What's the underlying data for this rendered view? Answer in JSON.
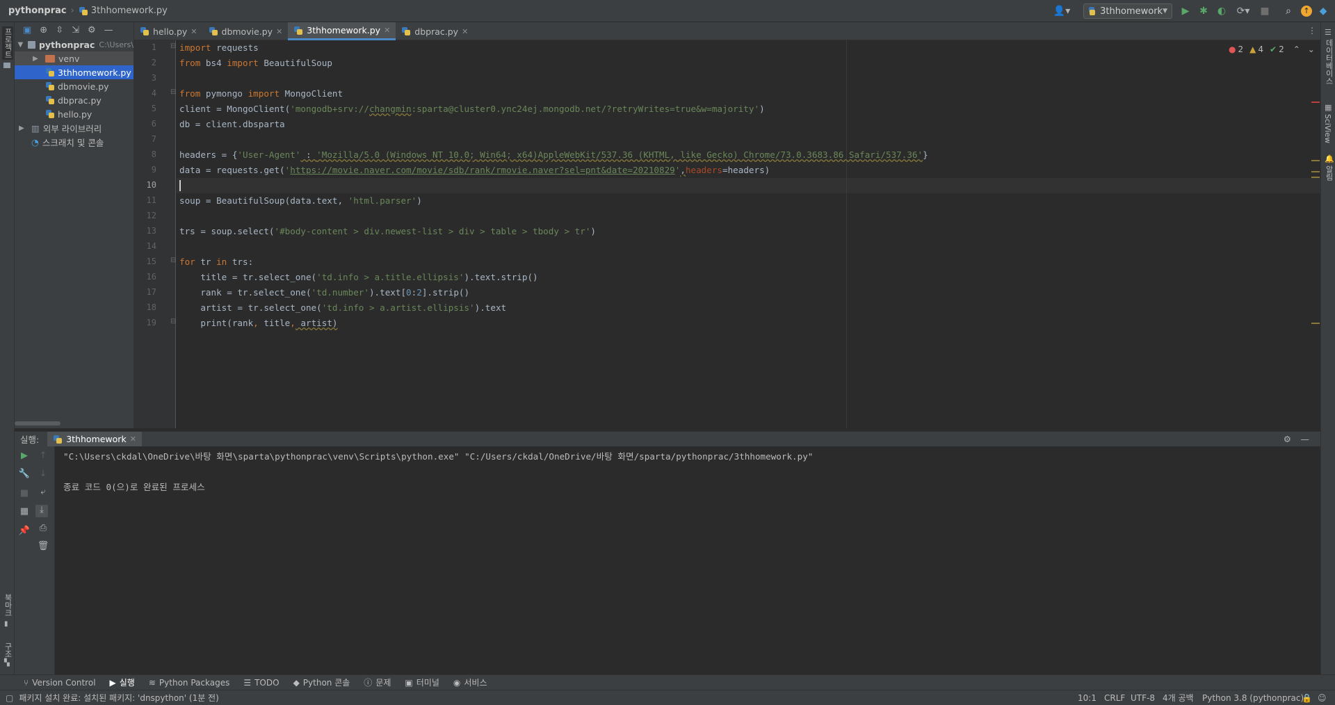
{
  "breadcrumb": {
    "project": "pythonprac",
    "file": "3thhomework.py"
  },
  "toolbar": {
    "run_config": "3thhomework"
  },
  "left_strip": {
    "project_label": "프로젝트",
    "bookmarks_label": "북마크",
    "structure_label": "구조"
  },
  "right_strip": {
    "database_label": "데이터베이스",
    "sciview_label": "SciView",
    "notifications_label": "알림"
  },
  "project_tree": {
    "root_name": "pythonprac",
    "root_path": "C:\\Users\\",
    "items": [
      {
        "label": "venv"
      },
      {
        "label": "3thhomework.py"
      },
      {
        "label": "dbmovie.py"
      },
      {
        "label": "dbprac.py"
      },
      {
        "label": "hello.py"
      },
      {
        "label": "외부 라이브러리"
      },
      {
        "label": "스크래치 및 콘솔"
      }
    ]
  },
  "tabs": [
    {
      "label": "hello.py"
    },
    {
      "label": "dbmovie.py"
    },
    {
      "label": "3thhomework.py"
    },
    {
      "label": "dbprac.py"
    }
  ],
  "inspections": {
    "errors": "2",
    "warnings": "4",
    "ok": "2"
  },
  "code": {
    "line_numbers": [
      "1",
      "2",
      "3",
      "4",
      "5",
      "6",
      "7",
      "8",
      "9",
      "10",
      "11",
      "12",
      "13",
      "14",
      "15",
      "16",
      "17",
      "18",
      "19"
    ],
    "l1_kw": "import",
    "l1_mod": " requests",
    "l2_kw1": "from",
    "l2_mod": " bs4 ",
    "l2_kw2": "import",
    "l2_name": " BeautifulSoup",
    "l4_kw1": "from",
    "l4_mod": " pymongo ",
    "l4_kw2": "import",
    "l4_name": " MongoClient",
    "l5_pre": "client = MongoClient(",
    "l5_str1": "'mongodb+srv://",
    "l5_user": "changmin",
    "l5_str2": ":sparta@cluster0.ync24ej.mongodb.net/?retryWrites=true&w=majority'",
    "l5_post": ")",
    "l6": "db = client.dbsparta",
    "l8_pre": "headers = {",
    "l8_key": "'User-Agent'",
    "l8_colon": " : ",
    "l8_val": "'Mozilla/5.0 (Windows NT 10.0; Win64; x64)AppleWebKit/537.36 (KHTML, like Gecko) Chrome/73.0.3683.86 Safari/537.36'",
    "l8_post": "}",
    "l9_pre": "data = requests.get(",
    "l9_q1": "'",
    "l9_url": "https://movie.naver.com/movie/sdb/rank/rmovie.naver?sel=pnt&date=20210829",
    "l9_q2": "'",
    "l9_comma": ",",
    "l9_named": "headers",
    "l9_post": "=headers)",
    "l11_pre": "soup = BeautifulSoup(data.text, ",
    "l11_str": "'html.parser'",
    "l11_post": ")",
    "l13_pre": "trs = soup.select(",
    "l13_str": "'#body-content > div.newest-list > div > table > tbody > tr'",
    "l13_post": ")",
    "l15_kw1": "for",
    "l15_mid": " tr ",
    "l15_kw2": "in",
    "l15_post": " trs:",
    "l16_pre": "    title = tr.select_one(",
    "l16_str": "'td.info > a.title.ellipsis'",
    "l16_post": ").text.strip()",
    "l17_pre": "    rank = tr.select_one(",
    "l17_str": "'td.number'",
    "l17_mid": ").text[",
    "l17_n1": "0",
    "l17_colon": ":",
    "l17_n2": "2",
    "l17_post": "].strip()",
    "l18_pre": "    artist = tr.select_one(",
    "l18_str": "'td.info > a.artist.ellipsis'",
    "l18_post": ").text",
    "l19_pre": "    print(rank",
    "l19_c1": ",",
    "l19_mid": " title",
    "l19_c2": ",",
    "l19_post": " artist)"
  },
  "run_panel": {
    "label": "실행:",
    "tab": "3thhomework",
    "command": "\"C:\\Users\\ckdal\\OneDrive\\바탕 화면\\sparta\\pythonprac\\venv\\Scripts\\python.exe\" \"C:/Users/ckdal/OneDrive/바탕 화면/sparta/pythonprac/3thhomework.py\"",
    "exit_message": "종료 코드 0(으)로 완료된 프로세스"
  },
  "bottom_tools": [
    {
      "label": "Version Control"
    },
    {
      "label": "실행"
    },
    {
      "label": "Python Packages"
    },
    {
      "label": "TODO"
    },
    {
      "label": "Python 콘솔"
    },
    {
      "label": "문제"
    },
    {
      "label": "터미널"
    },
    {
      "label": "서비스"
    }
  ],
  "status": {
    "message": "패키지 설치 완료: 설치된 패키지: 'dnspython' (1분 전)",
    "position": "10:1",
    "line_sep": "CRLF",
    "encoding": "UTF-8",
    "indent": "4개 공백",
    "interpreter": "Python 3.8 (pythonprac)"
  },
  "colors": {
    "keyword": "#cc7832",
    "string": "#6a8759",
    "number": "#6897bb",
    "accent": "#4a88c7",
    "selection": "#2f65ca"
  }
}
